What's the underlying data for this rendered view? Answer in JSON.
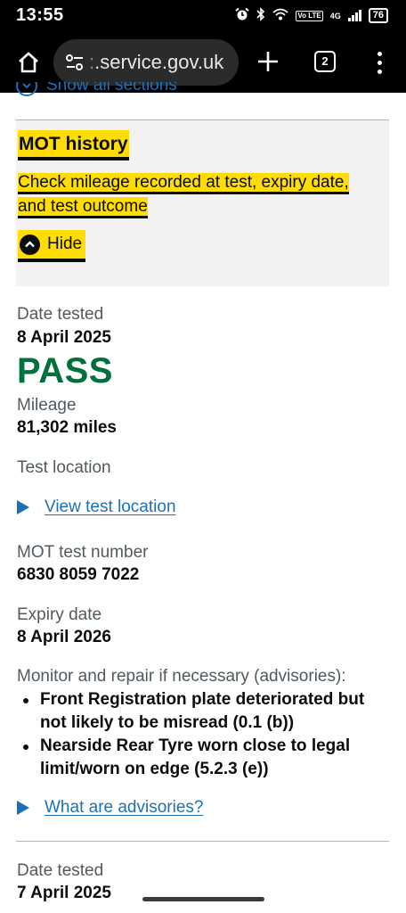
{
  "status_bar": {
    "time": "13:55",
    "icons": [
      "alarm-icon",
      "bluetooth-icon",
      "wifi-icon",
      "volte-icon",
      "signal-icon"
    ],
    "network_badge": "Vo LTE",
    "network_type": "4G",
    "battery": "76"
  },
  "browser": {
    "url_faded": "",
    "url": ".service.gov.uk",
    "tab_count": "2"
  },
  "accordion": {
    "show_all_label": "Show all sections",
    "section_title": "MOT history",
    "section_summary": "Check mileage recorded at test, expiry date, and test outcome",
    "toggle_label": "Hide"
  },
  "test_1": {
    "date_label": "Date tested",
    "date_value": "8 April 2025",
    "result": "PASS",
    "mileage_label": "Mileage",
    "mileage_value": "81,302 miles",
    "location_label": "Test location",
    "location_link": "View test location",
    "test_number_label": "MOT test number",
    "test_number_value": "6830 8059 7022",
    "expiry_label": "Expiry date",
    "expiry_value": "8 April 2026",
    "advisories_label": "Monitor and repair if necessary (advisories):",
    "advisories": [
      "Front Registration plate deteriorated but not likely to be misread (0.1 (b))",
      "Nearside Rear Tyre worn close to legal limit/worn on edge (5.2.3 (e))"
    ],
    "advisories_link": "What are advisories?"
  },
  "test_2": {
    "date_label": "Date tested",
    "date_value": "7 April 2025"
  },
  "colors": {
    "link": "#1d70b8",
    "pass": "#00703c",
    "focus_highlight": "#ffdd00",
    "panel_bg": "#f3f2f1"
  }
}
